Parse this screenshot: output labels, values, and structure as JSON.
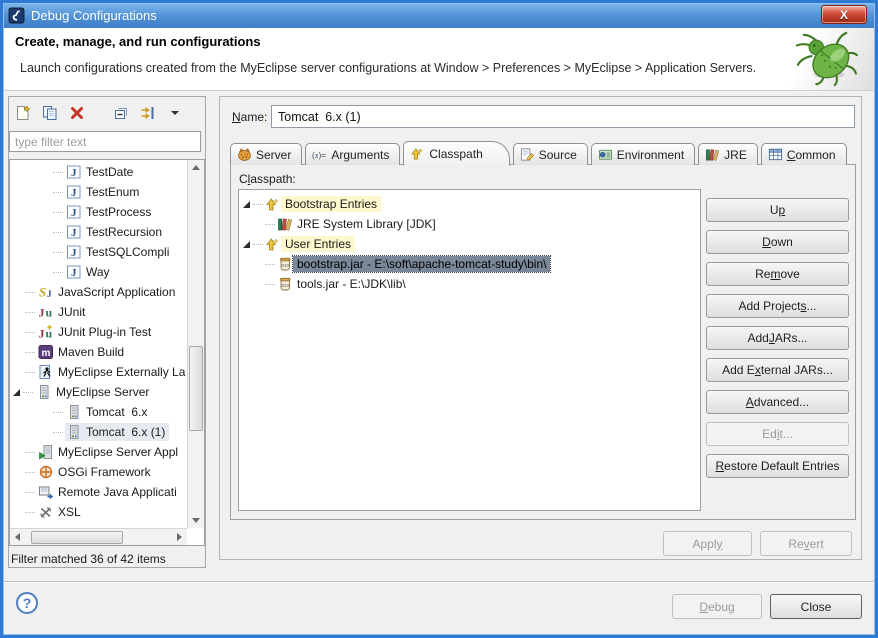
{
  "colors": {
    "titlebar_top": "#7db7ec",
    "titlebar_bottom": "#3d7ec6",
    "window_border": "#2f7ad2",
    "close_button_red": "#c0392b",
    "selection_bg": "#7b8899",
    "inactive_selection_bg": "#e7ebf1",
    "entry_highlight_yellow": "#fdf8cd",
    "help_accent": "#4f7dbf"
  },
  "window": {
    "title": "Debug Configurations",
    "close_glyph": "X"
  },
  "banner": {
    "title": "Create, manage, and run configurations",
    "description": "Launch configurations created from the MyEclipse server configurations at Window > Preferences > MyEclipse > Application Servers."
  },
  "left_panel": {
    "toolbar_icons": [
      "new-launch-configuration",
      "duplicate-launch-configuration",
      "delete-launch-configuration",
      "collapse-all",
      "filter-launch-configurations",
      "filter-menu-dropdown"
    ],
    "filter_placeholder": "type filter text",
    "tree": [
      {
        "label": "TestDate",
        "icon": "java-application",
        "level": 2
      },
      {
        "label": "TestEnum",
        "icon": "java-application",
        "level": 2
      },
      {
        "label": "TestProcess",
        "icon": "java-application",
        "level": 2
      },
      {
        "label": "TestRecursion",
        "icon": "java-application",
        "level": 2
      },
      {
        "label": "TestSQLCompli",
        "icon": "java-application",
        "level": 2
      },
      {
        "label": "Way",
        "icon": "java-application",
        "level": 2
      },
      {
        "label": "JavaScript Application",
        "icon": "javascript",
        "level": 1
      },
      {
        "label": "JUnit",
        "icon": "junit",
        "level": 1
      },
      {
        "label": "JUnit Plug-in Test",
        "icon": "junit-plugin",
        "level": 1
      },
      {
        "label": "Maven Build",
        "icon": "maven",
        "level": 1
      },
      {
        "label": "MyEclipse Externally La",
        "icon": "myeclipse-external",
        "level": 1
      },
      {
        "label": "MyEclipse Server",
        "icon": "server",
        "level": 1,
        "expanded": true
      },
      {
        "label": "Tomcat  6.x",
        "icon": "server",
        "level": 2
      },
      {
        "label": "Tomcat  6.x (1)",
        "icon": "server",
        "level": 2,
        "selected": true
      },
      {
        "label": "MyEclipse Server Appl",
        "icon": "server-application",
        "level": 1
      },
      {
        "label": "OSGi Framework",
        "icon": "osgi",
        "level": 1
      },
      {
        "label": "Remote Java Applicati",
        "icon": "remote-java",
        "level": 1
      },
      {
        "label": "XSL",
        "icon": "xsl",
        "level": 1
      }
    ],
    "status": "Filter matched 36 of 42 items"
  },
  "right_panel": {
    "name_label": "Name:",
    "name_mnemonic": 0,
    "name_value": "Tomcat  6.x (1)",
    "tabs": [
      {
        "label": "Server",
        "icon": "tomcat-cat"
      },
      {
        "label": "Arguments",
        "icon": "arguments"
      },
      {
        "label": "Classpath",
        "icon": "classpath-entries",
        "selected": true
      },
      {
        "label": "Source",
        "icon": "source"
      },
      {
        "label": "Environment",
        "icon": "environment"
      },
      {
        "label": "JRE",
        "icon": "library"
      },
      {
        "label": "Common",
        "icon": "table",
        "mnemonic": 0
      }
    ],
    "classpath_label": "Classpath:",
    "classpath_mnemonic": 1,
    "classpath_tree": [
      {
        "label": "Bootstrap Entries",
        "icon": "classpath-entries",
        "level": 0,
        "expanded": true,
        "highlighted": true
      },
      {
        "label": "JRE System Library [JDK]",
        "icon": "library",
        "level": 1
      },
      {
        "label": "User Entries",
        "icon": "classpath-entries",
        "level": 0,
        "expanded": true,
        "highlighted": true
      },
      {
        "label": "bootstrap.jar - E:\\soft\\apache-tomcat-study\\bin\\",
        "icon": "jar",
        "level": 1,
        "selected": true
      },
      {
        "label": "tools.jar - E:\\JDK\\lib\\",
        "icon": "jar",
        "level": 1
      }
    ],
    "buttons": [
      {
        "label": "Up",
        "mnemonic": 1,
        "enabled": true
      },
      {
        "label": "Down",
        "mnemonic": 0,
        "enabled": true
      },
      {
        "label": "Remove",
        "mnemonic": 2,
        "enabled": true
      },
      {
        "label": "Add Projects...",
        "mnemonic": 11,
        "enabled": true
      },
      {
        "label": "Add JARs...",
        "mnemonic": 4,
        "enabled": true
      },
      {
        "label": "Add External JARs...",
        "mnemonic": 5,
        "enabled": true
      },
      {
        "label": "Advanced...",
        "mnemonic": 0,
        "enabled": true
      },
      {
        "label": "Edit...",
        "mnemonic": 2,
        "enabled": false
      },
      {
        "label": "Restore Default Entries",
        "mnemonic": 0,
        "enabled": true
      }
    ],
    "apply": {
      "label": "Apply",
      "mnemonic": 4,
      "enabled": false
    },
    "revert": {
      "label": "Revert",
      "mnemonic": 2,
      "enabled": false
    }
  },
  "footer": {
    "help_glyph": "?",
    "debug": {
      "label": "Debug",
      "mnemonic": 0,
      "enabled": false
    },
    "close": {
      "label": "Close",
      "enabled": true
    }
  }
}
